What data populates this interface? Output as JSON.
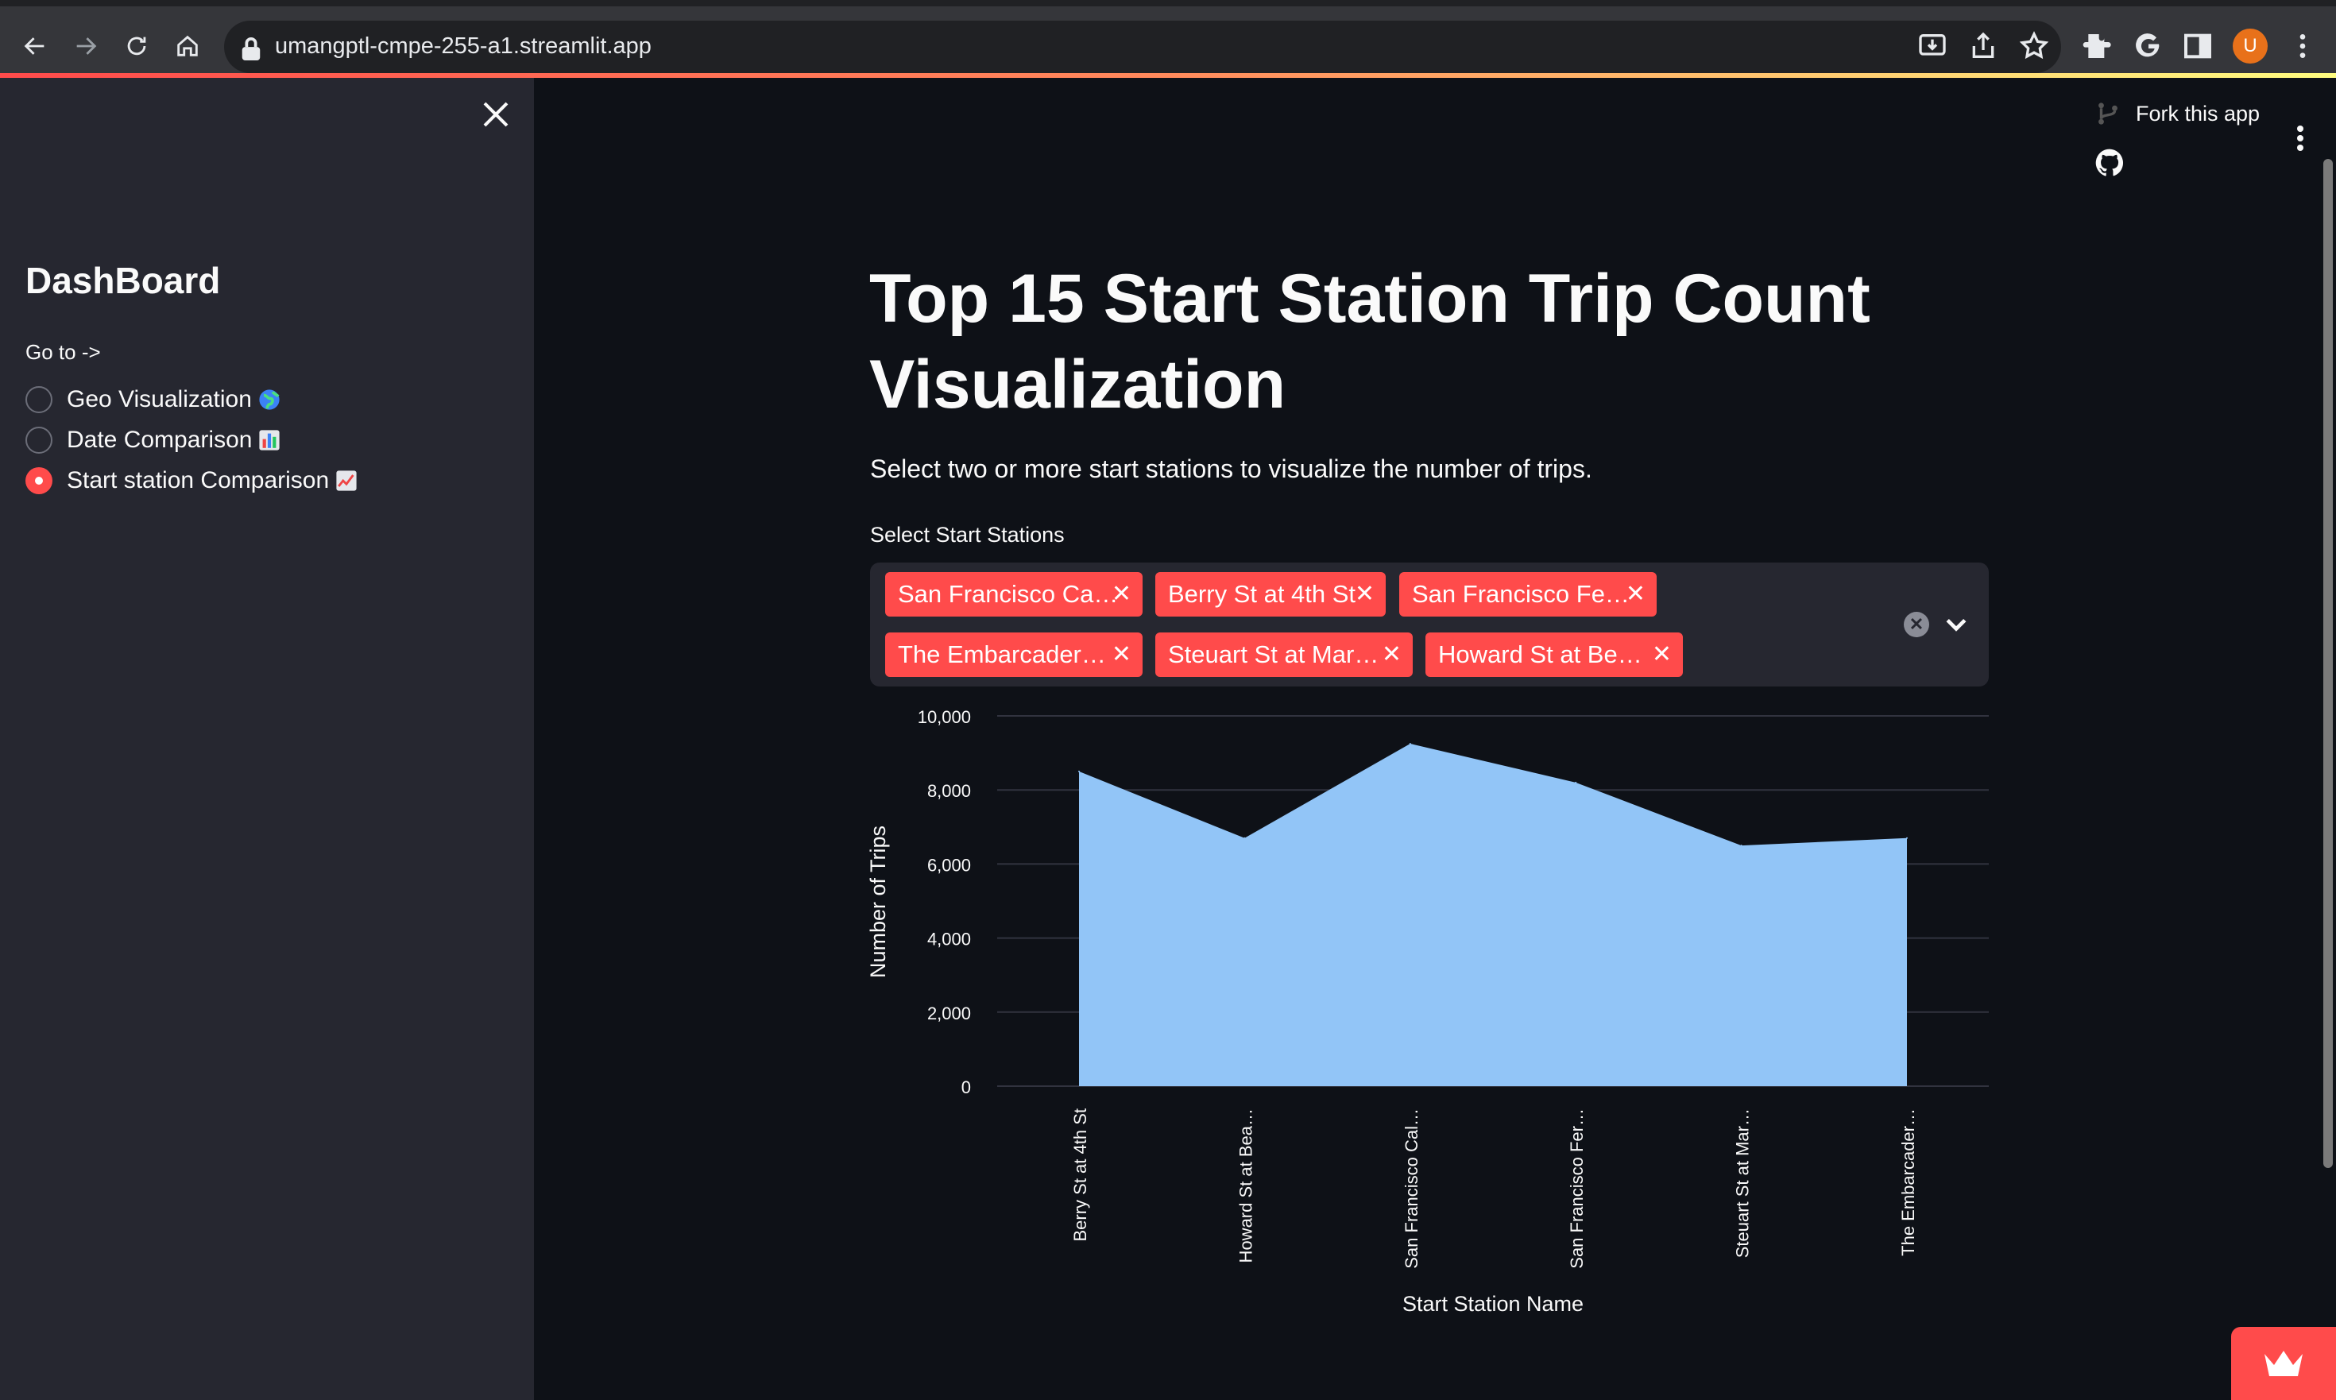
{
  "browser": {
    "url": "umangptl-cmpe-255-a1.streamlit.app",
    "avatar_letter": "U"
  },
  "sidebar": {
    "title": "DashBoard",
    "goto_label": "Go to ->",
    "options": [
      {
        "label": "Geo Visualization",
        "emoji": "globe",
        "selected": false
      },
      {
        "label": "Date Comparison",
        "emoji": "bar-chart",
        "selected": false
      },
      {
        "label": "Start station Comparison",
        "emoji": "chart-increasing",
        "selected": true
      }
    ]
  },
  "header": {
    "fork_label": "Fork this app"
  },
  "main": {
    "title": "Top 15 Start Station Trip Count Visualization",
    "subtitle": "Select two or more start stations to visualize the number of trips.",
    "multiselect_label": "Select Start Stations",
    "chips": [
      "San Francisco Ca…",
      "Berry St at 4th St",
      "San Francisco Fe…",
      "The Embarcader…",
      "Steuart St at Mar…",
      "Howard St at Be…"
    ]
  },
  "chart_data": {
    "type": "area",
    "categories": [
      "Berry St at 4th St",
      "Howard St at Bea…",
      "San Francisco Cal…",
      "San Francisco Fer…",
      "Steuart St at Mar…",
      "The Embarcader…"
    ],
    "values": [
      8500,
      6700,
      9250,
      8200,
      6500,
      6700
    ],
    "xlabel": "Start Station Name",
    "ylabel": "Number of Trips",
    "ylim": [
      0,
      10000
    ],
    "yticks": [
      "0",
      "2,000",
      "4,000",
      "6,000",
      "8,000",
      "10,000"
    ],
    "color": "#92c5f7",
    "grid": true
  },
  "colors": {
    "accent": "#ff4b4b",
    "background": "#0e1117",
    "sidebar": "#262730",
    "area": "#92c5f7"
  }
}
